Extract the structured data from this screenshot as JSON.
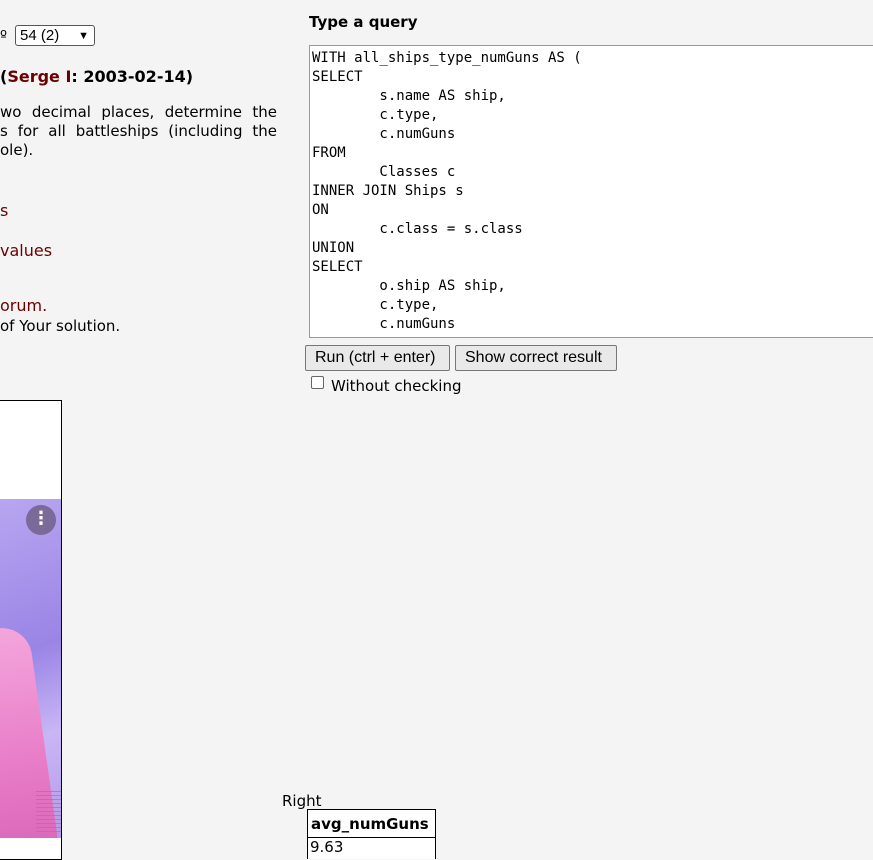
{
  "task": {
    "number_prefix": "º",
    "selected_task": "54 (2)",
    "heading_prefix": "(",
    "author": "Serge I",
    "date_suffix": ": 2003-02-14)",
    "text_lines": [
      "wo decimal places, determine the",
      "s for all battleships (including the"
    ],
    "text_last_line": "ole).",
    "link_1": "s",
    "link_2": "values",
    "link_3": "orum.",
    "note": "of Your solution."
  },
  "query": {
    "title": "Type a query",
    "sql": "WITH all_ships_type_numGuns AS (\nSELECT\n        s.name AS ship,\n        c.type,\n        c.numGuns\nFROM\n        Classes c\nINNER JOIN Ships s\nON\n        c.class = s.class\nUNION\nSELECT\n        o.ship AS ship,\n        c.type,\n        c.numGuns"
  },
  "buttons": {
    "run_label": "Run (ctrl + enter)",
    "show_result_label": "Show correct result"
  },
  "options": {
    "without_checking_label": "Without checking",
    "without_checking_checked": false
  },
  "ad": {
    "menu_glyph": "⋮"
  },
  "result": {
    "label": "Right",
    "column": "avg_numGuns",
    "value": "9.63"
  }
}
